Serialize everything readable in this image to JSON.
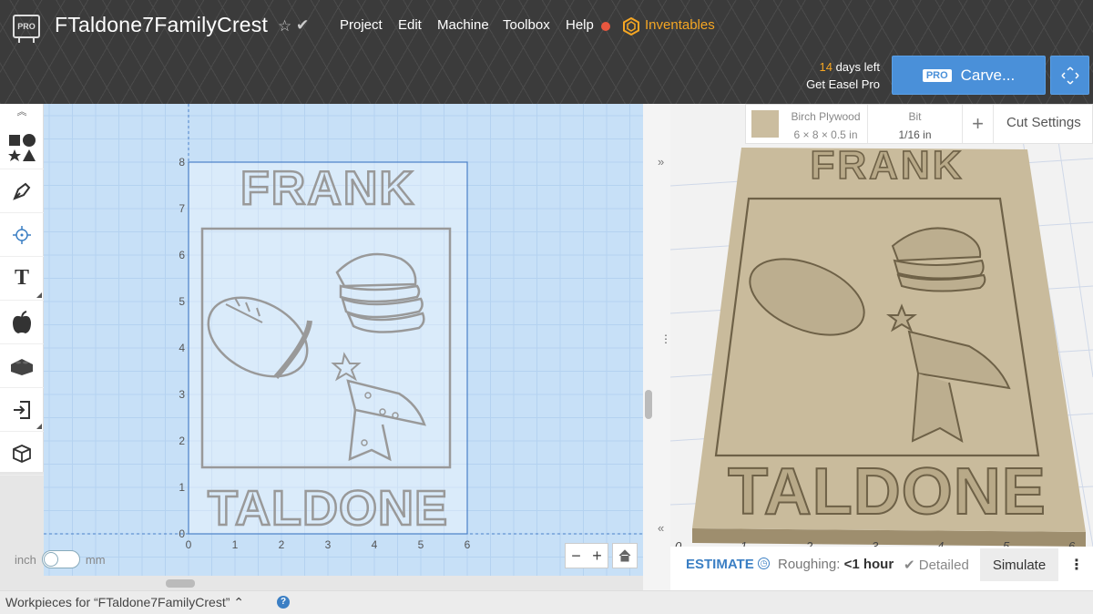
{
  "header": {
    "logo_text": "PRO",
    "project_title": "FTaldone7FamilyCrest",
    "menu": [
      "Project",
      "Edit",
      "Machine",
      "Toolbox",
      "Help"
    ],
    "inventables_label": "Inventables",
    "days_left_num": "14",
    "days_left_text": " days left",
    "get_pro_label": "Get Easel Pro",
    "carve_badge": "PRO",
    "carve_label": "Carve..."
  },
  "design": {
    "y_ticks": [
      "0",
      "1",
      "2",
      "3",
      "4",
      "5",
      "6",
      "7",
      "8"
    ],
    "x_ticks": [
      "0",
      "1",
      "2",
      "3",
      "4",
      "5",
      "6"
    ],
    "text_top": "FRANK",
    "text_bottom": "TALDONE"
  },
  "units": {
    "left": "inch",
    "right": "mm",
    "selected": "inch"
  },
  "zoom": {
    "minus": "−",
    "plus": "+"
  },
  "material": {
    "name": "Birch Plywood",
    "dims": "6 × 8 × 0.5 in",
    "bit_label": "Bit",
    "bit_value": "1/16 in",
    "plus": "+",
    "cut_settings": "Cut Settings",
    "swatch_color": "#cbbd9f"
  },
  "preview": {
    "x_ticks": [
      "0",
      "1",
      "2",
      "3",
      "4",
      "5",
      "6"
    ],
    "text_top": "FRANK",
    "text_bottom": "TALDONE"
  },
  "estimate": {
    "label": "ESTIMATE",
    "roughing_label": "Roughing: ",
    "roughing_value": "<1 hour",
    "detailed_label": "Detailed",
    "simulate_label": "Simulate"
  },
  "bottom": {
    "workpieces_label": "Workpieces for “FTaldone7FamilyCrest” ⌃"
  },
  "colors": {
    "accent": "#4a90d9",
    "inventables": "#f5a623",
    "canvas": "#c7e0f7",
    "wood": "#c9bb9c"
  }
}
